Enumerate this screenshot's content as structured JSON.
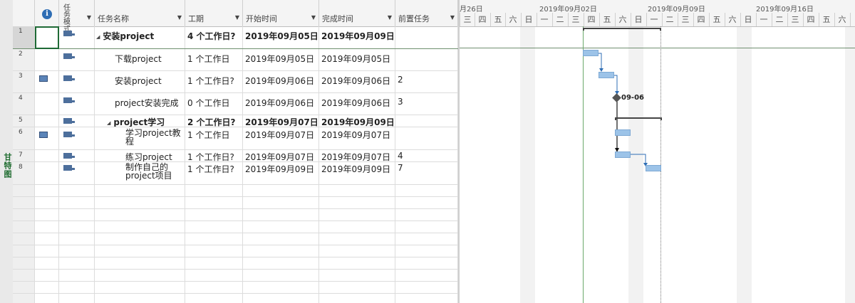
{
  "sidebar": {
    "view_label": "甘特图"
  },
  "columns": {
    "info_icon": "i",
    "task_mode": "任务模式",
    "task_name": "任务名称",
    "duration": "工期",
    "start": "开始时间",
    "finish": "完成时间",
    "predecessors": "前置任务"
  },
  "tasks": [
    {
      "id": "1",
      "name": "安装project",
      "duration": "4 个工作日?",
      "start": "2019年09月05日",
      "finish": "2019年09月09日",
      "pred": "",
      "summary": true,
      "icon": "auto-schedule-icon",
      "note": ""
    },
    {
      "id": "2",
      "name": "下载project",
      "duration": "1 个工作日",
      "start": "2019年09月05日",
      "finish": "2019年09月05日",
      "pred": "",
      "summary": false,
      "icon": "auto-schedule-icon",
      "note": ""
    },
    {
      "id": "3",
      "name": "安装project",
      "duration": "1 个工作日?",
      "start": "2019年09月06日",
      "finish": "2019年09月06日",
      "pred": "2",
      "summary": false,
      "icon": "auto-schedule-icon",
      "note": "table-icon"
    },
    {
      "id": "4",
      "name": "project安装完成",
      "duration": "0 个工作日",
      "start": "2019年09月06日",
      "finish": "2019年09月06日",
      "pred": "3",
      "summary": false,
      "icon": "auto-schedule-icon",
      "note": ""
    },
    {
      "id": "5",
      "name": "project学习",
      "duration": "2 个工作日?",
      "start": "2019年09月07日",
      "finish": "2019年09月09日",
      "pred": "",
      "summary": true,
      "icon": "auto-schedule-icon",
      "note": ""
    },
    {
      "id": "6",
      "name": "学习project教程",
      "duration": "1 个工作日",
      "start": "2019年09月07日",
      "finish": "2019年09月07日",
      "pred": "",
      "summary": false,
      "icon": "auto-schedule-icon",
      "note": "table-icon"
    },
    {
      "id": "7",
      "name": "练习project",
      "duration": "1 个工作日?",
      "start": "2019年09月07日",
      "finish": "2019年09月07日",
      "pred": "4",
      "summary": false,
      "icon": "auto-schedule-icon",
      "note": ""
    },
    {
      "id": "8",
      "name": "制作自己的project项目",
      "duration": "1 个工作日?",
      "start": "2019年09月09日",
      "finish": "2019年09月09日",
      "pred": "7",
      "summary": false,
      "icon": "auto-schedule-icon",
      "note": ""
    }
  ],
  "timescale": {
    "weeks": [
      "月26日",
      "2019年09月02日",
      "2019年09月09日",
      "2019年09月16日"
    ],
    "days": [
      "三",
      "四",
      "五",
      "六",
      "日",
      "一",
      "二",
      "三",
      "四",
      "五",
      "六",
      "日",
      "一",
      "二",
      "三",
      "四",
      "五",
      "六",
      "日",
      "一",
      "二",
      "三",
      "四",
      "五",
      "六",
      "日"
    ]
  },
  "milestone_label": "09-06",
  "colors": {
    "bar": "#9cc3e8",
    "view_label": "#1d6b2e",
    "link": "#2e6db4",
    "info": "#2e6db4"
  }
}
